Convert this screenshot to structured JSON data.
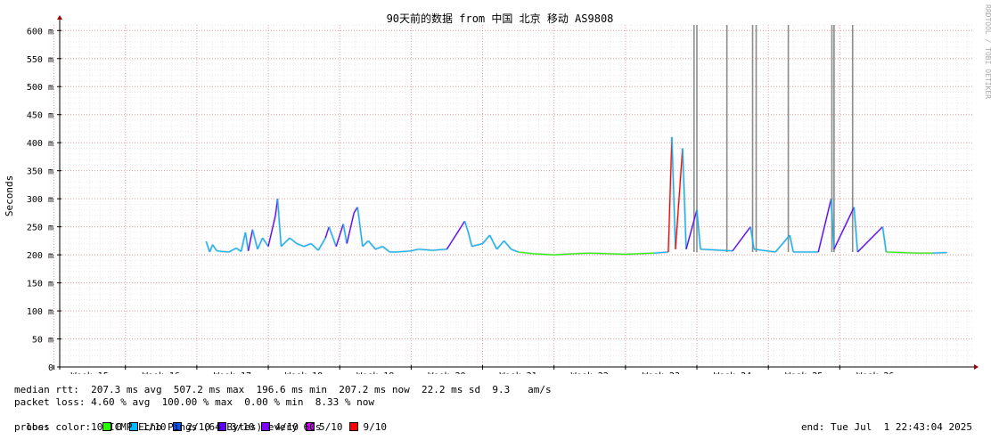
{
  "chart_data": {
    "type": "line",
    "title": "90天前的数据 from 中国 北京 移动 AS9808",
    "ylabel": "Seconds",
    "xlabel": "",
    "watermark": "RRDTOOL / TOBI OETIKER",
    "ylim": [
      0,
      0.61
    ],
    "y_ticks": [
      {
        "value": 0,
        "label": "0"
      },
      {
        "value": 0.05,
        "label": "50 m"
      },
      {
        "value": 0.1,
        "label": "100 m"
      },
      {
        "value": 0.15,
        "label": "150 m"
      },
      {
        "value": 0.2,
        "label": "200 m"
      },
      {
        "value": 0.25,
        "label": "250 m"
      },
      {
        "value": 0.3,
        "label": "300 m"
      },
      {
        "value": 0.35,
        "label": "350 m"
      },
      {
        "value": 0.4,
        "label": "400 m"
      },
      {
        "value": 0.45,
        "label": "450 m"
      },
      {
        "value": 0.5,
        "label": "500 m"
      },
      {
        "value": 0.55,
        "label": "550 m"
      },
      {
        "value": 0.6,
        "label": "600 m"
      }
    ],
    "x_range_weeks": [
      14.58,
      27.38
    ],
    "x_ticks": [
      {
        "week": 15,
        "label": "Week 15"
      },
      {
        "week": 16,
        "label": "Week 16"
      },
      {
        "week": 17,
        "label": "Week 17"
      },
      {
        "week": 18,
        "label": "Week 18"
      },
      {
        "week": 19,
        "label": "Week 19"
      },
      {
        "week": 20,
        "label": "Week 20"
      },
      {
        "week": 21,
        "label": "Week 21"
      },
      {
        "week": 22,
        "label": "Week 22"
      },
      {
        "week": 23,
        "label": "Week 23"
      },
      {
        "week": 24,
        "label": "Week 24"
      },
      {
        "week": 25,
        "label": "Week 25"
      },
      {
        "week": 26,
        "label": "Week 26"
      }
    ],
    "grid": true,
    "median_rtt": [
      [
        16.63,
        0.224
      ],
      [
        16.68,
        0.205
      ],
      [
        16.72,
        0.218
      ],
      [
        16.78,
        0.207
      ],
      [
        16.85,
        0.206
      ],
      [
        16.95,
        0.205
      ],
      [
        17.05,
        0.212
      ],
      [
        17.12,
        0.206
      ],
      [
        17.18,
        0.24
      ],
      [
        17.22,
        0.207
      ],
      [
        17.28,
        0.245
      ],
      [
        17.35,
        0.21
      ],
      [
        17.42,
        0.23
      ],
      [
        17.5,
        0.215
      ],
      [
        17.6,
        0.27
      ],
      [
        17.63,
        0.3
      ],
      [
        17.68,
        0.215
      ],
      [
        17.8,
        0.23
      ],
      [
        17.9,
        0.22
      ],
      [
        18.0,
        0.215
      ],
      [
        18.1,
        0.22
      ],
      [
        18.2,
        0.208
      ],
      [
        18.3,
        0.23
      ],
      [
        18.35,
        0.25
      ],
      [
        18.45,
        0.215
      ],
      [
        18.55,
        0.255
      ],
      [
        18.6,
        0.22
      ],
      [
        18.7,
        0.275
      ],
      [
        18.75,
        0.285
      ],
      [
        18.82,
        0.215
      ],
      [
        18.9,
        0.225
      ],
      [
        19.0,
        0.21
      ],
      [
        19.1,
        0.215
      ],
      [
        19.2,
        0.205
      ],
      [
        19.3,
        0.205
      ],
      [
        19.5,
        0.207
      ],
      [
        19.6,
        0.21
      ],
      [
        19.8,
        0.208
      ],
      [
        20.0,
        0.21
      ],
      [
        20.25,
        0.26
      ],
      [
        20.3,
        0.24
      ],
      [
        20.35,
        0.215
      ],
      [
        20.5,
        0.22
      ],
      [
        20.6,
        0.235
      ],
      [
        20.7,
        0.21
      ],
      [
        20.8,
        0.225
      ],
      [
        20.9,
        0.21
      ],
      [
        21.0,
        0.205
      ],
      [
        21.2,
        0.202
      ],
      [
        21.5,
        0.2
      ],
      [
        21.8,
        0.202
      ],
      [
        22.0,
        0.203
      ],
      [
        22.5,
        0.201
      ],
      [
        22.9,
        0.203
      ],
      [
        23.1,
        0.205
      ],
      [
        23.15,
        0.41
      ],
      [
        23.2,
        0.21
      ],
      [
        23.3,
        0.39
      ],
      [
        23.35,
        0.21
      ],
      [
        23.5,
        0.28
      ],
      [
        23.55,
        0.21
      ],
      [
        24.0,
        0.207
      ],
      [
        24.25,
        0.25
      ],
      [
        24.3,
        0.21
      ],
      [
        24.6,
        0.205
      ],
      [
        24.8,
        0.235
      ],
      [
        24.85,
        0.205
      ],
      [
        25.2,
        0.205
      ],
      [
        25.38,
        0.3
      ],
      [
        25.42,
        0.21
      ],
      [
        25.7,
        0.285
      ],
      [
        25.75,
        0.205
      ],
      [
        26.1,
        0.25
      ],
      [
        26.15,
        0.205
      ],
      [
        26.6,
        0.203
      ],
      [
        26.8,
        0.203
      ],
      [
        27.0,
        0.204
      ]
    ],
    "spikes": [
      23.46,
      23.5,
      23.92,
      24.28,
      24.33,
      24.78,
      25.39,
      25.42,
      25.68
    ],
    "legend_series": [
      {
        "name": "0",
        "color": "#26ff00"
      },
      {
        "name": "1/10",
        "color": "#00b8ff"
      },
      {
        "name": "2/10",
        "color": "#0059ff"
      },
      {
        "name": "3/10",
        "color": "#5e00ff"
      },
      {
        "name": "4/10",
        "color": "#7e00ff"
      },
      {
        "name": "5/10",
        "color": "#dd00ff"
      },
      {
        "name": "9/10",
        "color": "#ff0000"
      }
    ]
  },
  "legend": {
    "median_rtt": "median rtt:  207.3 ms avg  507.2 ms max  196.6 ms min  207.2 ms now  22.2 ms sd  9.3   am/s",
    "packet_loss": "packet loss: 4.60 % avg  100.00 % max  0.00 % min  8.33 % now",
    "loss_color_label": "loss color:  ",
    "probe": "probe:       10 ICMP Echo Pings (64 Bytes) every 60s",
    "end": "end: Tue Jul  1 22:43:04 2025"
  }
}
